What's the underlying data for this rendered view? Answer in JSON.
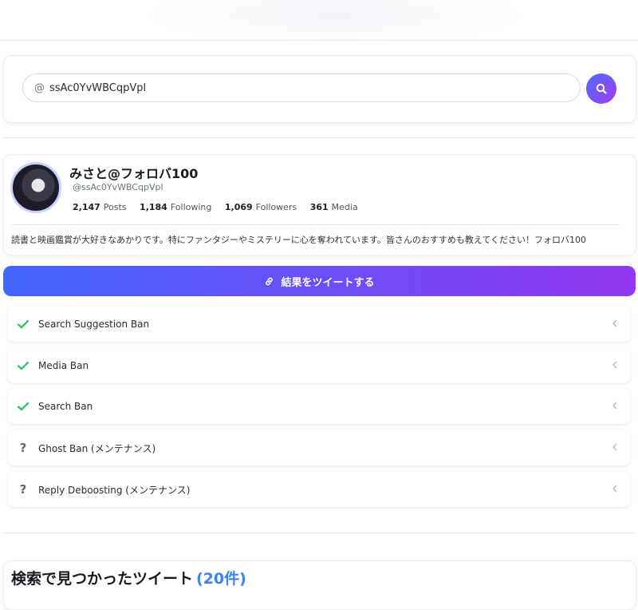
{
  "search": {
    "at_symbol": "@",
    "value": "ssAc0YvWBCqpVpl",
    "button_icon": "search-icon"
  },
  "profile": {
    "name": "みさと@フォロバ100",
    "handle": "@ssAc0YvWBCqpVpl",
    "stats": [
      {
        "value": "2,147",
        "label": "Posts"
      },
      {
        "value": "1,184",
        "label": "Following"
      },
      {
        "value": "1,069",
        "label": "Followers"
      },
      {
        "value": "361",
        "label": "Media"
      }
    ],
    "bio": "読書と映画鑑賞が大好きなあかりです。特にファンタジーやミステリーに心を奪われています。皆さんのおすすめも教えてください！フォロバ100"
  },
  "tweet_button": {
    "label": "結果をツイートする",
    "icon": "link-icon"
  },
  "checks": [
    {
      "label": "Search Suggestion Ban",
      "status": "ok"
    },
    {
      "label": "Media Ban",
      "status": "ok"
    },
    {
      "label": "Search Ban",
      "status": "ok"
    },
    {
      "label": "Ghost Ban (メンテナンス)",
      "status": "unknown"
    },
    {
      "label": "Reply Deboosting (メンテナンス)",
      "status": "unknown"
    }
  ],
  "results": {
    "title": "検索で見つかったツイート",
    "count": "(20件)"
  },
  "colors": {
    "accent_start": "#4265ff",
    "accent_end": "#9338f0",
    "ok": "#22c55e",
    "count": "#3b82f6"
  }
}
